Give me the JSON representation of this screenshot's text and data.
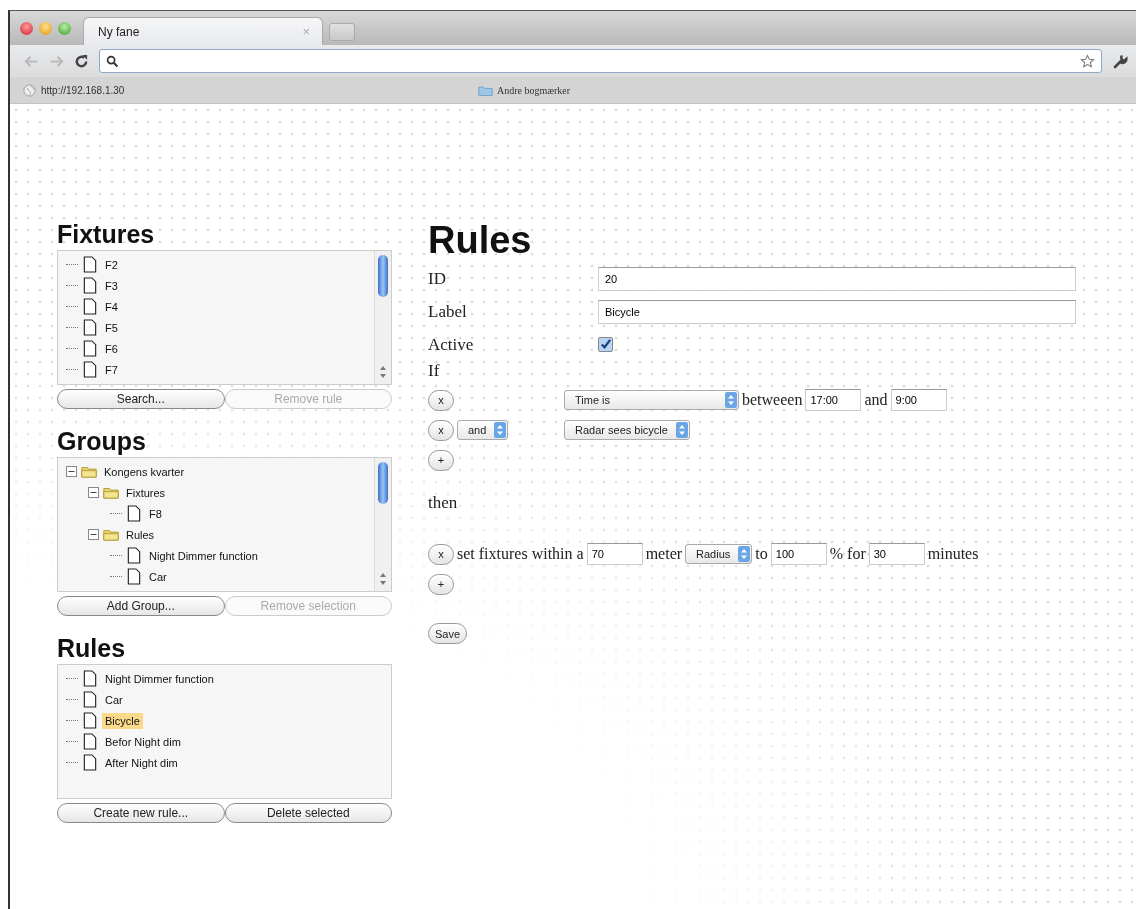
{
  "browser": {
    "tab": {
      "title": "Ny fane",
      "close": "×"
    },
    "bookmarks": [
      {
        "label": "http://192.168.1.30",
        "kind": "page"
      },
      {
        "label": "Andre bogmærker",
        "kind": "folder"
      }
    ]
  },
  "sidebar": [
    {
      "title": "Fixtures",
      "items": [
        {
          "label": "F2",
          "kind": "file",
          "selected": false
        },
        {
          "label": "F3",
          "kind": "file",
          "selected": false
        },
        {
          "label": "F4",
          "kind": "file",
          "selected": false
        },
        {
          "label": "F5",
          "kind": "file",
          "selected": false
        },
        {
          "label": "F6",
          "kind": "file",
          "selected": false
        },
        {
          "label": "F7",
          "kind": "file",
          "selected": false
        }
      ],
      "buttons": [
        {
          "label": "Search...",
          "disabled": false
        },
        {
          "label": "Remove rule",
          "disabled": true
        }
      ],
      "scrollbar": true
    },
    {
      "title": "Groups",
      "items": [
        {
          "label": "Kongens kvarter",
          "kind": "folder",
          "expanded": true,
          "selected": false,
          "children": [
            {
              "label": "Fixtures",
              "kind": "folder",
              "expanded": true,
              "selected": false,
              "children": [
                {
                  "label": "F8",
                  "kind": "file",
                  "selected": false
                }
              ]
            },
            {
              "label": "Rules",
              "kind": "folder",
              "expanded": true,
              "selected": false,
              "children": [
                {
                  "label": "Night Dimmer function",
                  "kind": "file",
                  "selected": false
                },
                {
                  "label": "Car",
                  "kind": "file",
                  "selected": false
                }
              ]
            }
          ]
        }
      ],
      "buttons": [
        {
          "label": "Add Group...",
          "disabled": false
        },
        {
          "label": "Remove selection",
          "disabled": true
        }
      ],
      "scrollbar": true
    },
    {
      "title": "Rules",
      "items": [
        {
          "label": "Night Dimmer function",
          "kind": "file",
          "selected": false
        },
        {
          "label": "Car",
          "kind": "file",
          "selected": false
        },
        {
          "label": "Bicycle",
          "kind": "file",
          "selected": true
        },
        {
          "label": "Befor Night dim",
          "kind": "file",
          "selected": false
        },
        {
          "label": "After Night dim",
          "kind": "file",
          "selected": false
        }
      ],
      "buttons": [
        {
          "label": "Create new rule...",
          "disabled": false
        },
        {
          "label": "Delete selected",
          "disabled": false
        }
      ],
      "scrollbar": false
    }
  ],
  "editor": {
    "title": "Rules",
    "fields": [
      {
        "label": "ID",
        "kind": "text",
        "value": "20"
      },
      {
        "label": "Label",
        "kind": "text",
        "value": "Bicycle"
      },
      {
        "label": "Active",
        "kind": "checkbox",
        "checked": true
      }
    ],
    "if_label": "If",
    "conditions": [
      {
        "remove": "x",
        "parts": [
          {
            "kind": "select",
            "value": "Time is",
            "wide": true
          },
          {
            "kind": "text",
            "value": "betweeen"
          },
          {
            "kind": "input",
            "value": "17:00"
          },
          {
            "kind": "text",
            "value": "and"
          },
          {
            "kind": "input",
            "value": "9:00"
          }
        ]
      },
      {
        "remove": "x",
        "connector": "and",
        "parts": [
          {
            "kind": "select",
            "value": "Radar sees bicycle",
            "wide": false
          }
        ]
      }
    ],
    "add_condition": "+",
    "then_label": "then",
    "actions": [
      {
        "remove": "x",
        "parts": [
          {
            "kind": "text",
            "value": "set fixtures within a"
          },
          {
            "kind": "input",
            "value": "70"
          },
          {
            "kind": "text",
            "value": "meter"
          },
          {
            "kind": "select",
            "value": "Radius",
            "wide": false
          },
          {
            "kind": "text",
            "value": "to"
          },
          {
            "kind": "input",
            "value": "100"
          },
          {
            "kind": "text",
            "value": "% for"
          },
          {
            "kind": "input",
            "value": "30"
          },
          {
            "kind": "text",
            "value": "minutes"
          }
        ]
      }
    ],
    "add_action": "+",
    "save": "Save"
  }
}
